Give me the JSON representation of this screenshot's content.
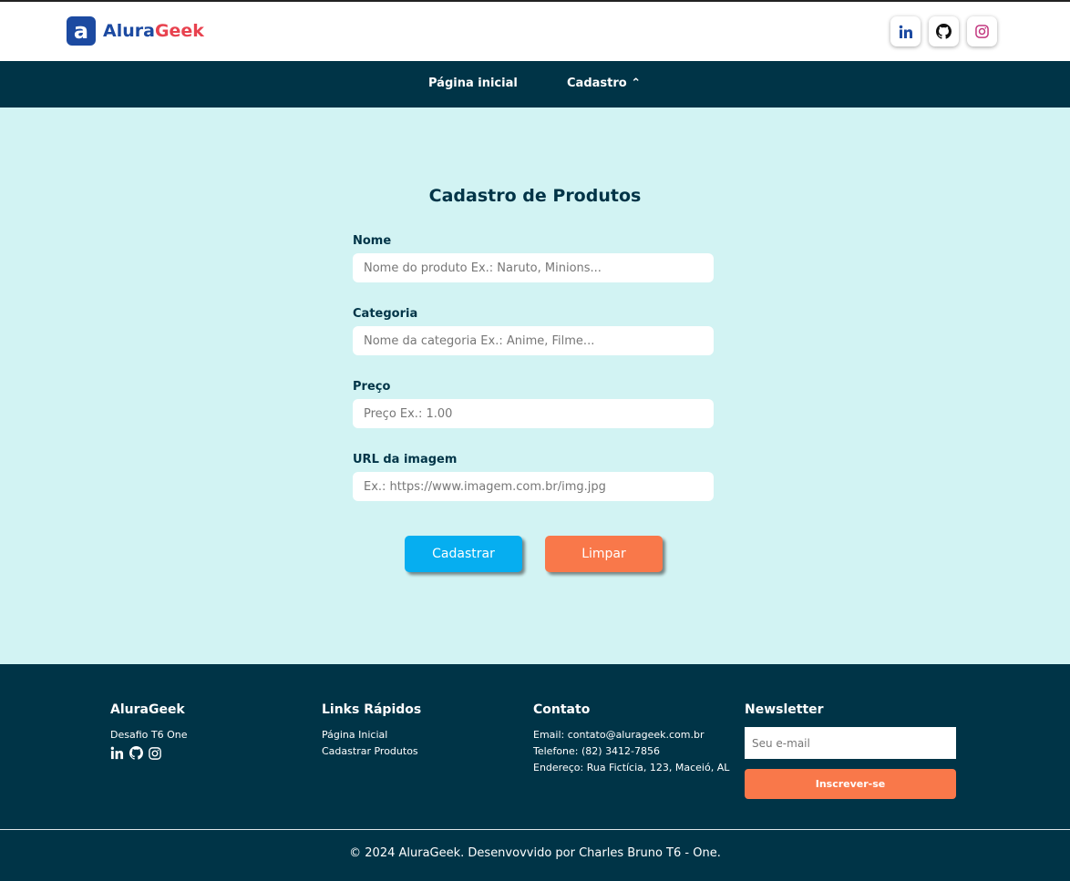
{
  "header": {
    "logo_mark": "a",
    "brand_part1": "Alura",
    "brand_part2": "Geek",
    "social_icons": [
      "linkedin-icon",
      "github-icon",
      "instagram-icon"
    ]
  },
  "nav": {
    "home": "Página inicial",
    "register": "Cadastro ⌃"
  },
  "form": {
    "title": "Cadastro de Produtos",
    "fields": [
      {
        "label": "Nome",
        "placeholder": "Nome do produto Ex.: Naruto, Minions..."
      },
      {
        "label": "Categoria",
        "placeholder": "Nome da categoria Ex.: Anime, Filme..."
      },
      {
        "label": "Preço",
        "placeholder": "Preço Ex.: 1.00"
      },
      {
        "label": "URL da imagem",
        "placeholder": "Ex.: https://www.imagem.com.br/img.jpg"
      }
    ],
    "submit_label": "Cadastrar",
    "clear_label": "Limpar"
  },
  "footer": {
    "about": {
      "title": "AluraGeek",
      "text": "Desafio T6 One"
    },
    "links": {
      "title": "Links Rápidos",
      "items": [
        "Página Inicial",
        "Cadastrar Produtos"
      ]
    },
    "contact": {
      "title": "Contato",
      "email": "Email: contato@alurageek.com.br",
      "phone": "Telefone: (82) 3412-7856",
      "address": "Endereço: Rua Fictícia, 123, Maceió, AL"
    },
    "newsletter": {
      "title": "Newsletter",
      "placeholder": "Seu e-mail",
      "button": "Inscrever-se"
    },
    "copyright": "© 2024 AluraGeek. Desenvovvido por Charles Bruno T6 - One."
  },
  "colors": {
    "brand_blue": "#1c4aa1",
    "brand_red": "#e8424f",
    "dark": "#003447",
    "background": "#d2f3f3",
    "primary_button": "#06aef0",
    "secondary_button": "#f9784a"
  }
}
